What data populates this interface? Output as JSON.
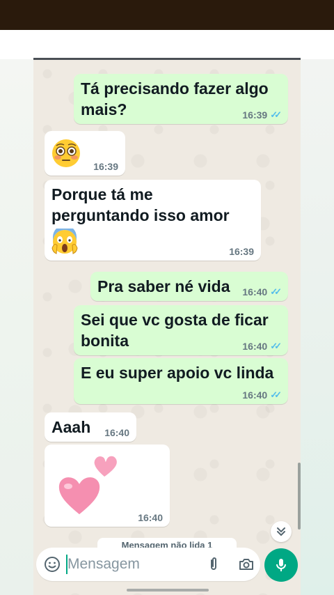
{
  "messages": [
    {
      "dir": "out",
      "text": "Tá precisando fazer algo mais?",
      "time": "16:39",
      "read": true
    },
    {
      "dir": "in",
      "emoji": "flushed-face",
      "time": "16:39"
    },
    {
      "dir": "in",
      "text": "Porque tá me perguntando isso amor",
      "emoji": "screaming-face",
      "time": "16:39"
    },
    {
      "dir": "out",
      "text": "Pra saber né vida",
      "time": "16:40",
      "read": true
    },
    {
      "dir": "out",
      "text": "Sei que vc gosta de ficar bonita",
      "time": "16:40",
      "read": true
    },
    {
      "dir": "out",
      "text": "E eu super apoio vc linda",
      "time": "16:40",
      "read": true
    },
    {
      "dir": "in",
      "text": "Aaah",
      "time": "16:40"
    },
    {
      "dir": "in",
      "emoji": "two-hearts",
      "time": "16:40"
    }
  ],
  "unread_banner": "Mensagem não lida 1",
  "compose": {
    "placeholder": "Mensagem"
  },
  "icons": {
    "emoji": "emoji-icon",
    "attach": "paperclip-icon",
    "camera": "camera-icon",
    "mic": "microphone-icon",
    "scroll": "double-chevron-down-icon",
    "read_receipt": "double-check-icon"
  },
  "colors": {
    "outgoing_bubble": "#d9fdd3",
    "incoming_bubble": "#ffffff",
    "chat_background": "#efeae2",
    "accent": "#00a884",
    "read_ticks": "#53bdeb",
    "top_bar": "#2a1a0c"
  }
}
